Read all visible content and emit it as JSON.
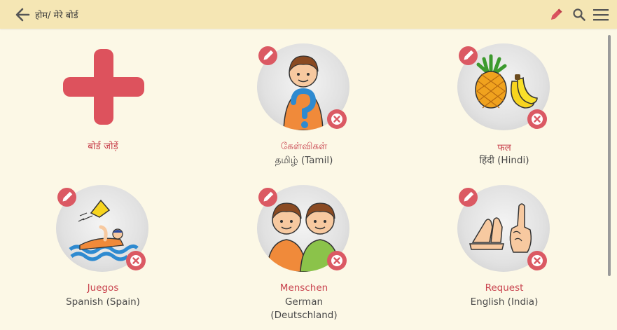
{
  "header": {
    "breadcrumb": "होम/ मेरे बोर्ड",
    "icons": [
      "back-arrow-icon",
      "pencil-icon",
      "search-icon",
      "menu-icon"
    ]
  },
  "add_board": {
    "label": "बोर्ड जोड़ें"
  },
  "boards": [
    {
      "name": "கேள்விகள்",
      "language": "தமிழ் (Tamil)",
      "icon": "boy-question-icon"
    },
    {
      "name": "फल",
      "language": "हिंदी (Hindi)",
      "icon": "fruits-icon"
    },
    {
      "name": "Juegos",
      "language": "Spanish (Spain)",
      "icon": "swimming-icon"
    },
    {
      "name": "Menschen",
      "language_line1": "German",
      "language_line2": "(Deutschland)",
      "icon": "two-boys-icon"
    },
    {
      "name": "Request",
      "language": "English (India)",
      "icon": "hands-request-icon"
    }
  ],
  "colors": {
    "accent": "#db5963",
    "header": "#f5e6b4",
    "background": "#fcf8e6"
  }
}
